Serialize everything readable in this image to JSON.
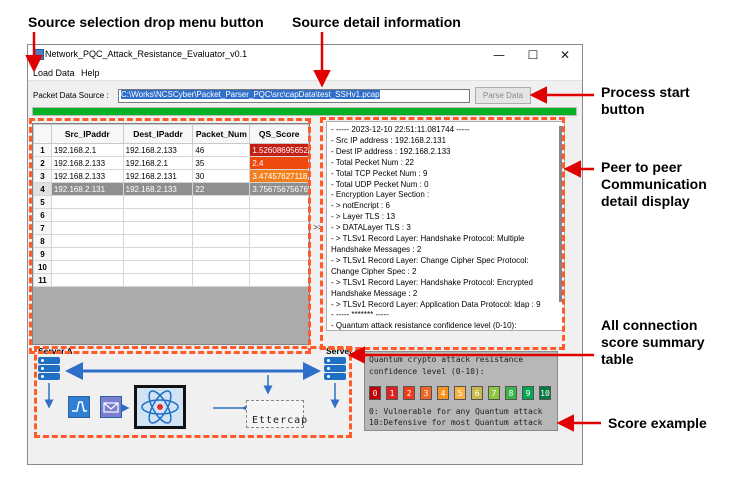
{
  "annotations": {
    "source_menu": "Source selection drop menu button",
    "source_detail": "Source detail information",
    "process_start": [
      "Process start",
      "button"
    ],
    "p2p_display": [
      "Peer to peer",
      "Communication",
      "detail display"
    ],
    "summary_table": [
      "All connection",
      "score summary",
      "table"
    ],
    "score_example": "Score example"
  },
  "window": {
    "title": "Network_PQC_Attack_Resistance_Evaluator_v0.1",
    "menu": [
      "Load Data",
      "Help"
    ],
    "controls": {
      "minimize": "—",
      "maximize": "☐",
      "close": "✕"
    }
  },
  "source": {
    "label": "Packet Data Source :",
    "value": "C:\\Works\\NCSCyber\\Packet_Parser_PQC\\src\\capData\\test_SSHv1.pcap",
    "parse_button": "Parse Data",
    "progress_fraction": 1.0
  },
  "table": {
    "columns": [
      "Src_IPaddr",
      "Dest_IPaddr",
      "Packet_Num",
      "QS_Score"
    ],
    "rows": [
      {
        "num": "1",
        "src": "192.168.2.1",
        "dst": "192.168.2.133",
        "packets": "46",
        "score": "1.52608695652",
        "color": "#c41f12"
      },
      {
        "num": "2",
        "src": "192.168.2.133",
        "dst": "192.168.2.1",
        "packets": "35",
        "score": "2.4",
        "color": "#ee4a10"
      },
      {
        "num": "3",
        "src": "192.168.2.133",
        "dst": "192.168.2.131",
        "packets": "30",
        "score": "3.47457627118",
        "color": "#f3801f"
      },
      {
        "num": "4",
        "src": "192.168.2.131",
        "dst": "192.168.2.133",
        "packets": "22",
        "score": "3.75675675676",
        "color": ""
      }
    ],
    "empty_rows": [
      "5",
      "6",
      "7",
      "8",
      "9",
      "10",
      "11"
    ],
    "selected_row": "4",
    "expand_label": ">>"
  },
  "detail": {
    "lines": [
      "- ----- 2023-12-10 22:51:11.081744 -----",
      "- Src IP address : 192.168.2.131",
      "- Dest IP address : 192.168.2.133",
      "- Total Pecket Num : 22",
      "- Total TCP Pecket Num : 9",
      "- Total UDP Pecket Num : 0",
      "- Encryption Layer Section :",
      "- > notEncript : 6",
      "- > Layer TLS : 13",
      "- > DATALayer TLS : 3",
      "- > TLSv1 Record Layer: Handshake Protocol: Multiple Handshake Messages : 2",
      "- > TLSv1 Record Layer: Change Cipher Spec Protocol: Change Cipher Spec : 2",
      "- > TLSv1 Record Layer: Handshake Protocol: Encrypted Handshake Message : 2",
      "- > TLSv1 Record Layer: Application Data Protocol: ldap : 9",
      "- ----- ******* -----",
      "- Quantum attack resistance confidence level (0-10):"
    ]
  },
  "diagram": {
    "server_a": "Server A",
    "server_b": "Server B",
    "ettercap_label": "Ettercap"
  },
  "score_panel": {
    "title_line1": "Quantum crypto attack resistance",
    "title_line2": "confidence level (0-10):",
    "levels": [
      {
        "label": "0",
        "color": "#c00000"
      },
      {
        "label": "1",
        "color": "#e02020"
      },
      {
        "label": "2",
        "color": "#ee3b1c"
      },
      {
        "label": "3",
        "color": "#f26522"
      },
      {
        "label": "4",
        "color": "#f7931e"
      },
      {
        "label": "5",
        "color": "#fbb040"
      },
      {
        "label": "6",
        "color": "#c9b84a"
      },
      {
        "label": "7",
        "color": "#8dc63f"
      },
      {
        "label": "8",
        "color": "#39b54a"
      },
      {
        "label": "9",
        "color": "#00a651"
      },
      {
        "label": "10",
        "color": "#007a3d"
      }
    ],
    "line_low": "0: Vulnerable for any Quantum attack",
    "line_high": "10:Defensive for most Quantum attack"
  },
  "colors": {
    "annotation_red": "#e00000",
    "dash_orange": "#ff5a28",
    "progress_green": "#06b025",
    "server_blue": "#1f6fc5"
  }
}
